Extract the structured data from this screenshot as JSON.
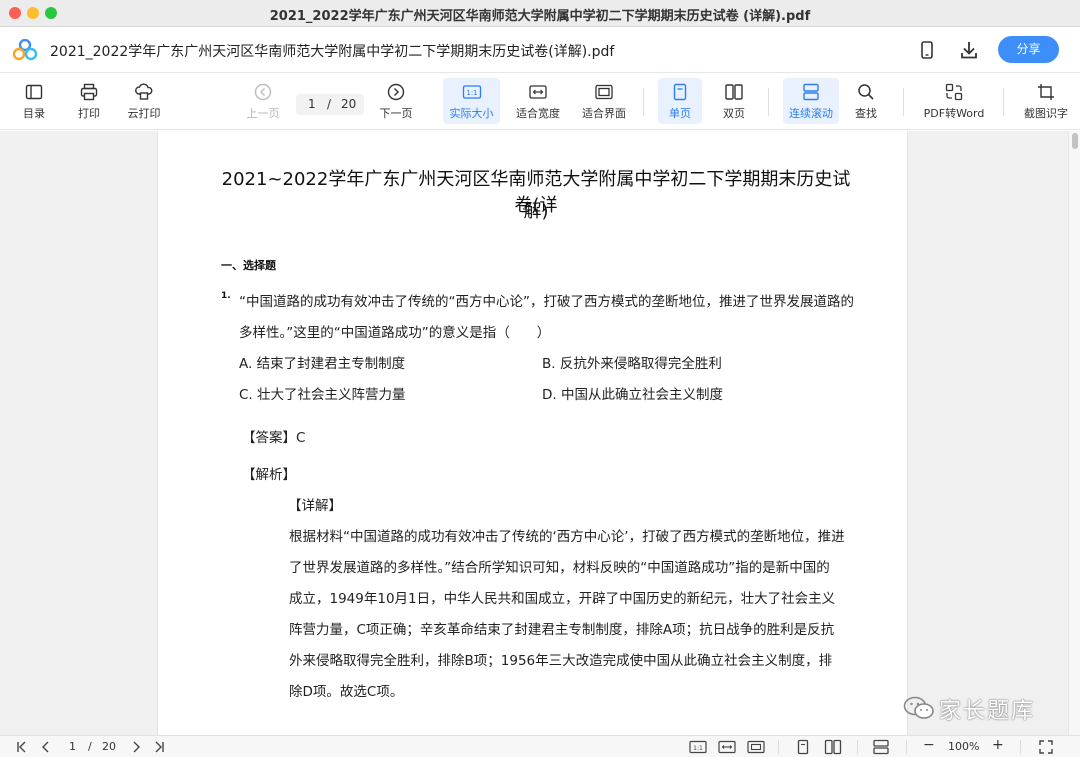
{
  "window": {
    "title": "2021_2022学年广东广州天河区华南师范大学附属中学初二下学期期末历史试卷 (详解).pdf"
  },
  "docbar": {
    "title": "2021_2022学年广东广州天河区华南师范大学附属中学初二下学期期末历史试卷(详解).pdf",
    "share_label": "分享",
    "icons": [
      "app-logo",
      "phone-icon",
      "download-icon"
    ]
  },
  "toolbar": {
    "toc": "目录",
    "print": "打印",
    "cloud_print": "云打印",
    "prev_page": "上一页",
    "current_page": "1",
    "page_sep": "/",
    "total_pages": "20",
    "next_page": "下一页",
    "actual_size": "实际大小",
    "fit_width": "适合宽度",
    "fit_page": "适合界面",
    "single_page": "单页",
    "double_page": "双页",
    "continuous_scroll": "连续滚动",
    "find": "查找",
    "pdf_to_word": "PDF转Word",
    "ocr": "截图识字",
    "actual_size_glyph": "1:1",
    "accent_color": "#2a7df2"
  },
  "document": {
    "heading_line1": "2021~2022学年广东广州天河区华南师范大学附属中学初二下学期期末历史试卷(详",
    "heading_line2": "解)",
    "section": "一、选择题",
    "question_number": "1.",
    "question_lines": [
      "“中国道路的成功有效冲击了传统的“西方中心论”，打破了西方模式的垄断地位，推进了世界发展道路的",
      "多样性。”这里的“中国道路成功”的意义是指（　　）"
    ],
    "options": {
      "a": "A. 结束了封建君主专制制度",
      "b": "B. 反抗外来侵略取得完全胜利",
      "c": "C. 壮大了社会主义阵营力量",
      "d": "D. 中国从此确立社会主义制度"
    },
    "answer": "【答案】C",
    "analysis": "【解析】",
    "detail": "【详解】",
    "detail_lines": [
      "根据材料“中国道路的成功有效冲击了传统的‘西方中心论’，打破了西方模式的垄断地位，推进",
      "了世界发展道路的多样性。”结合所学知识可知，材料反映的“中国道路成功”指的是新中国的",
      "成立，1949年10月1日，中华人民共和国成立，开辟了中国历史的新纪元，壮大了社会主义",
      "阵营力量，C项正确；辛亥革命结束了封建君主专制制度，排除A项；抗日战争的胜利是反抗",
      "外来侵略取得完全胜利，排除B项；1956年三大改造完成使中国从此确立社会主义制度，排",
      "除D项。故选C项。"
    ]
  },
  "statusbar": {
    "current_page": "1",
    "page_sep": "/",
    "total_pages": "20",
    "zoom": "100%",
    "zoom_out": "−",
    "zoom_in": "+"
  },
  "watermark": {
    "text": "家长题库"
  }
}
